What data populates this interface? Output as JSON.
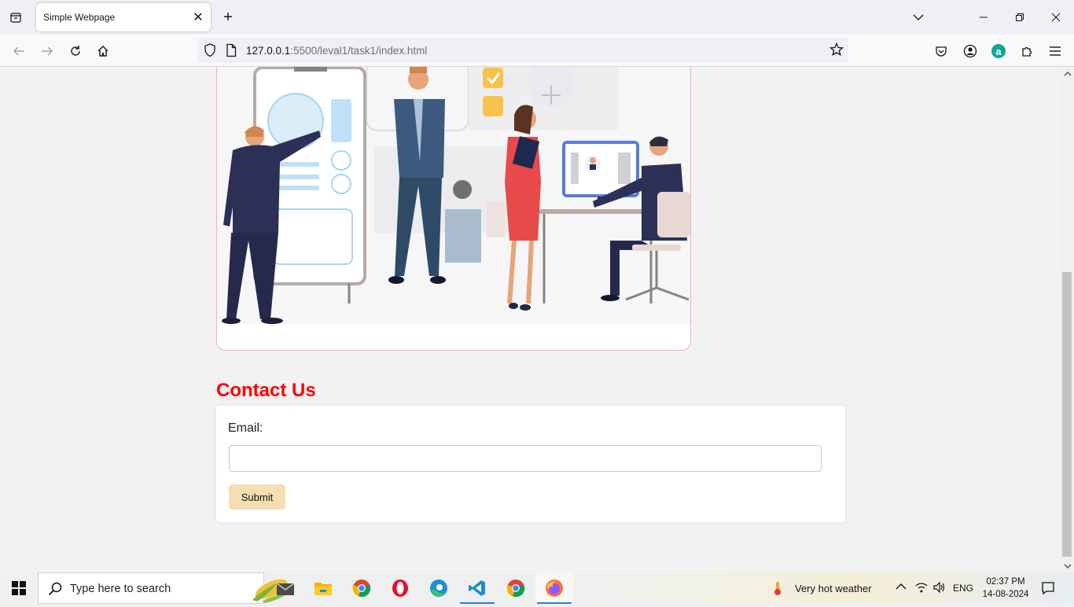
{
  "browser": {
    "tab_title": "Simple Webpage",
    "url_host": "127.0.0.1",
    "url_rest": ":5500/leval1/task1/index.html"
  },
  "page": {
    "contact_title": "Contact Us",
    "email_label": "Email:",
    "email_value": "",
    "submit_label": "Submit"
  },
  "taskbar": {
    "search_placeholder": "Type here to search",
    "weather": "Very hot weather",
    "language": "ENG",
    "time": "02:37 PM",
    "date": "14-08-2024",
    "apps": [
      "mail-icon",
      "file-explorer-icon",
      "chrome-icon",
      "opera-icon",
      "edge-icon",
      "vscode-icon",
      "chrome-icon",
      "firefox-icon"
    ]
  },
  "colors": {
    "heading": "#ff0000",
    "submit_bg": "#f5deb3",
    "card_border": "#f3b2b8"
  }
}
